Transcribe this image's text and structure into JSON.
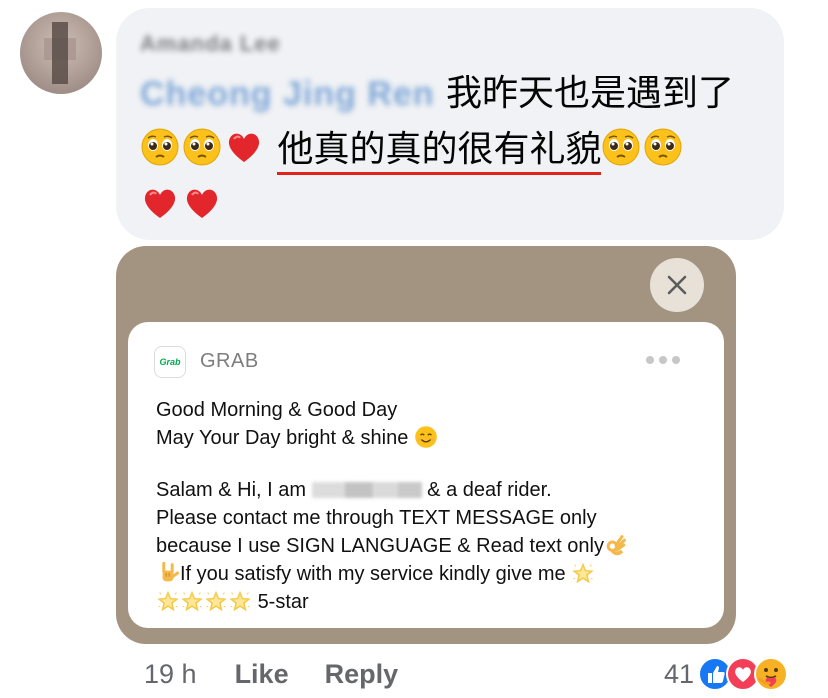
{
  "comment": {
    "author": "Amanda Lee",
    "mention": "Cheong Jing Ren",
    "text_line1": " 我昨天也是遇到了",
    "underlined_text": "他真的真的很有礼貌"
  },
  "attachment": {
    "app_logo": "Grab",
    "app_name": "GRAB",
    "message": {
      "line1": "Good Morning & Good Day",
      "line2": "May Your Day bright & shine",
      "line3_a": "Salam & Hi, I am",
      "line3_b": " & a deaf rider.",
      "line4": "Please contact me through TEXT MESSAGE only",
      "line5": "because I use SIGN LANGUAGE & Read text only",
      "line6": "If you satisfy with my service kindly give me",
      "line7": "5-star"
    }
  },
  "footer": {
    "time": "19 h",
    "like_label": "Like",
    "reply_label": "Reply",
    "reaction_count": "41"
  },
  "icons": {
    "pleading": "pleading-face-emoji",
    "heart": "red-heart-emoji",
    "smile": "smiling-face-emoji",
    "ok": "ok-hand-emoji",
    "love_you": "love-you-gesture-emoji",
    "star": "glowing-star-emoji",
    "reactions": [
      "like-reaction-icon",
      "love-reaction-icon",
      "care-reaction-icon"
    ]
  },
  "colors": {
    "bubble": "#f0f2f5",
    "attachment_bg": "#a39482",
    "underline": "#e0241b",
    "mention": "#7fa7d8",
    "like_blue": "#1877f2",
    "love_red": "#f33e58"
  }
}
